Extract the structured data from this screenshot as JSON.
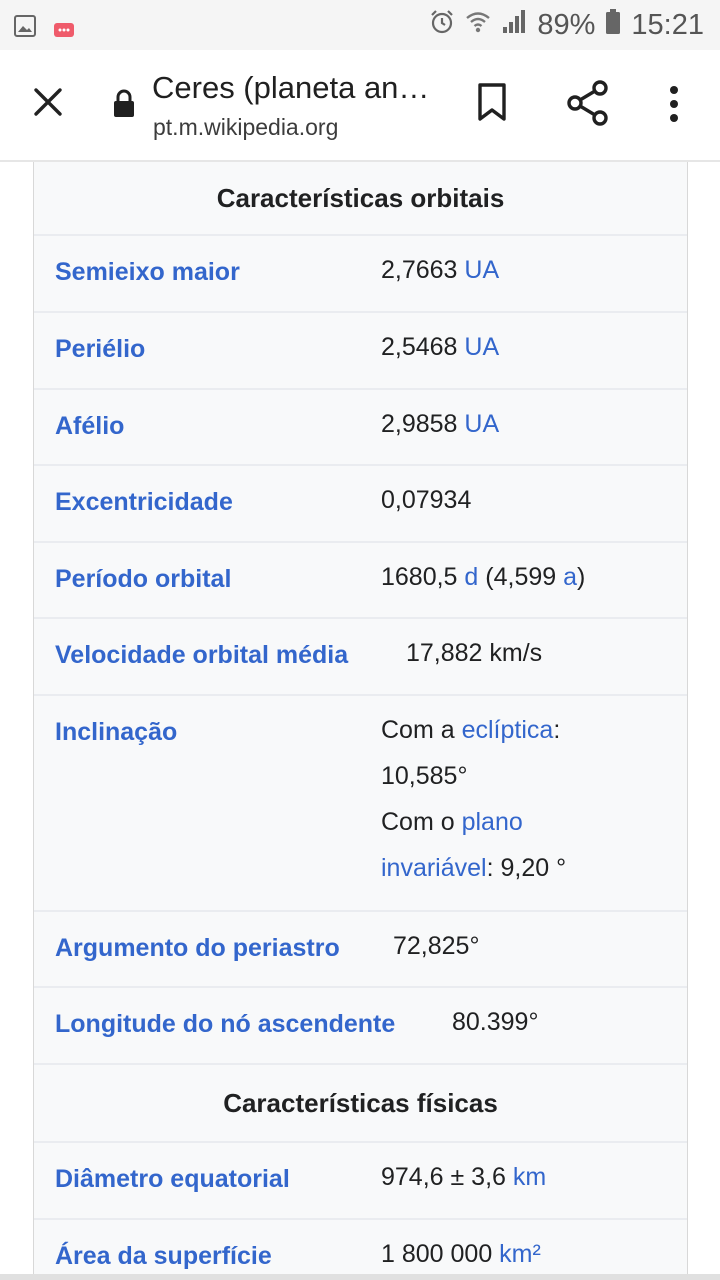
{
  "status_bar": {
    "battery_text": "89%",
    "time": "15:21"
  },
  "toolbar": {
    "page_title": "Ceres (planeta an…",
    "url": "pt.m.wikipedia.org"
  },
  "infobox": {
    "orbital_header": "Características orbitais",
    "physical_header": "Características físicas",
    "rows": {
      "semieixo": {
        "label": "Semieixo maior",
        "value": "2,7663 ",
        "unit": "UA"
      },
      "perielio": {
        "label": "Periélio",
        "value": "2,5468 ",
        "unit": "UA"
      },
      "afelio": {
        "label": "Afélio",
        "value": "2,9858 ",
        "unit": "UA"
      },
      "excentricidade": {
        "label": "Excentricidade",
        "value": "0,07934"
      },
      "periodo": {
        "label": "Período orbital",
        "value_a": "1680,5 ",
        "unit_d": "d",
        "value_b": " (4,599 ",
        "unit_a": "a",
        "value_c": ")"
      },
      "velocidade": {
        "label": "Velocidade orbital média",
        "value": "17,882 km/s"
      },
      "inclinacao": {
        "label": "Inclinação",
        "line1_prefix": "Com a ",
        "line1_link": "eclíptica",
        "line1_suffix": ":",
        "line2": "10,585°",
        "line3_prefix": "Com o ",
        "line3_link": "plano",
        "line4_link": "invariável",
        "line4_suffix": ": 9,20 °"
      },
      "periastro": {
        "label": "Argumento do periastro",
        "value": "72,825°"
      },
      "longitude": {
        "label": "Longitude do nó ascendente",
        "value": "80.399°"
      },
      "diametro": {
        "label": "Diâmetro equatorial",
        "value": "974,6 ± 3,6 ",
        "unit": "km"
      },
      "area": {
        "label": "Área da superfície",
        "value": "1 800 000 ",
        "unit": "km²"
      }
    }
  },
  "colors": {
    "link": "#3366cc",
    "infobox_bg": "#f8f9fa",
    "border": "#eaecf0"
  },
  "icons": [
    "gallery-icon",
    "notification-icon",
    "alarm-icon",
    "wifi-icon",
    "signal-icon",
    "battery-icon",
    "close-icon",
    "lock-icon",
    "bookmark-icon",
    "share-icon",
    "more-vert-icon"
  ]
}
